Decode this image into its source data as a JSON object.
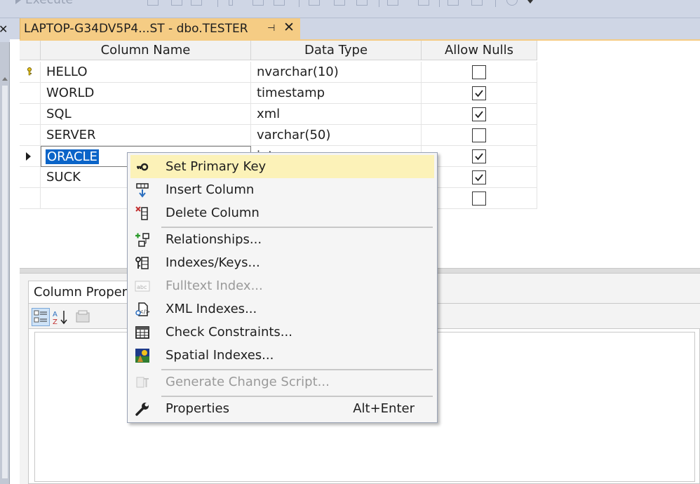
{
  "toolbar": {
    "execute_label": "Execute"
  },
  "tab": {
    "title": "LAPTOP-G34DV5P4...ST - dbo.TESTER",
    "pin_glyph": "⊣",
    "close_glyph": "✕"
  },
  "grid": {
    "headers": {
      "column_name": "Column Name",
      "data_type": "Data Type",
      "allow_nulls": "Allow Nulls"
    },
    "rows": [
      {
        "name": "HELLO",
        "type": "nvarchar(10)",
        "nulls": false,
        "primary_key": true
      },
      {
        "name": "WORLD",
        "type": "timestamp",
        "nulls": true
      },
      {
        "name": "SQL",
        "type": "xml",
        "nulls": true
      },
      {
        "name": "SERVER",
        "type": "varchar(50)",
        "nulls": false
      },
      {
        "name": "ORACLE",
        "type": "int",
        "nulls": true,
        "selected": true
      },
      {
        "name": "SUCK",
        "type": "",
        "nulls": true
      },
      {
        "name": "",
        "type": "",
        "nulls": false
      }
    ]
  },
  "properties": {
    "tab_label": "Column Properties"
  },
  "context_menu": {
    "items": [
      {
        "label": "Set Primary Key",
        "icon": "key-icon",
        "highlighted": true
      },
      {
        "label": "Insert Column",
        "icon": "insert-column-icon"
      },
      {
        "label": "Delete Column",
        "icon": "delete-column-icon"
      },
      {
        "label": "Relationships...",
        "icon": "relationships-icon"
      },
      {
        "label": "Indexes/Keys...",
        "icon": "indexes-keys-icon"
      },
      {
        "label": "Fulltext Index...",
        "icon": "fulltext-index-icon",
        "disabled": true
      },
      {
        "label": "XML Indexes...",
        "icon": "xml-indexes-icon"
      },
      {
        "label": "Check Constraints...",
        "icon": "check-constraints-icon"
      },
      {
        "label": "Spatial Indexes...",
        "icon": "spatial-indexes-icon"
      },
      {
        "label": "Generate Change Script...",
        "icon": "generate-script-icon",
        "disabled": true
      },
      {
        "label": "Properties",
        "icon": "wrench-icon",
        "shortcut": "Alt+Enter"
      }
    ]
  }
}
